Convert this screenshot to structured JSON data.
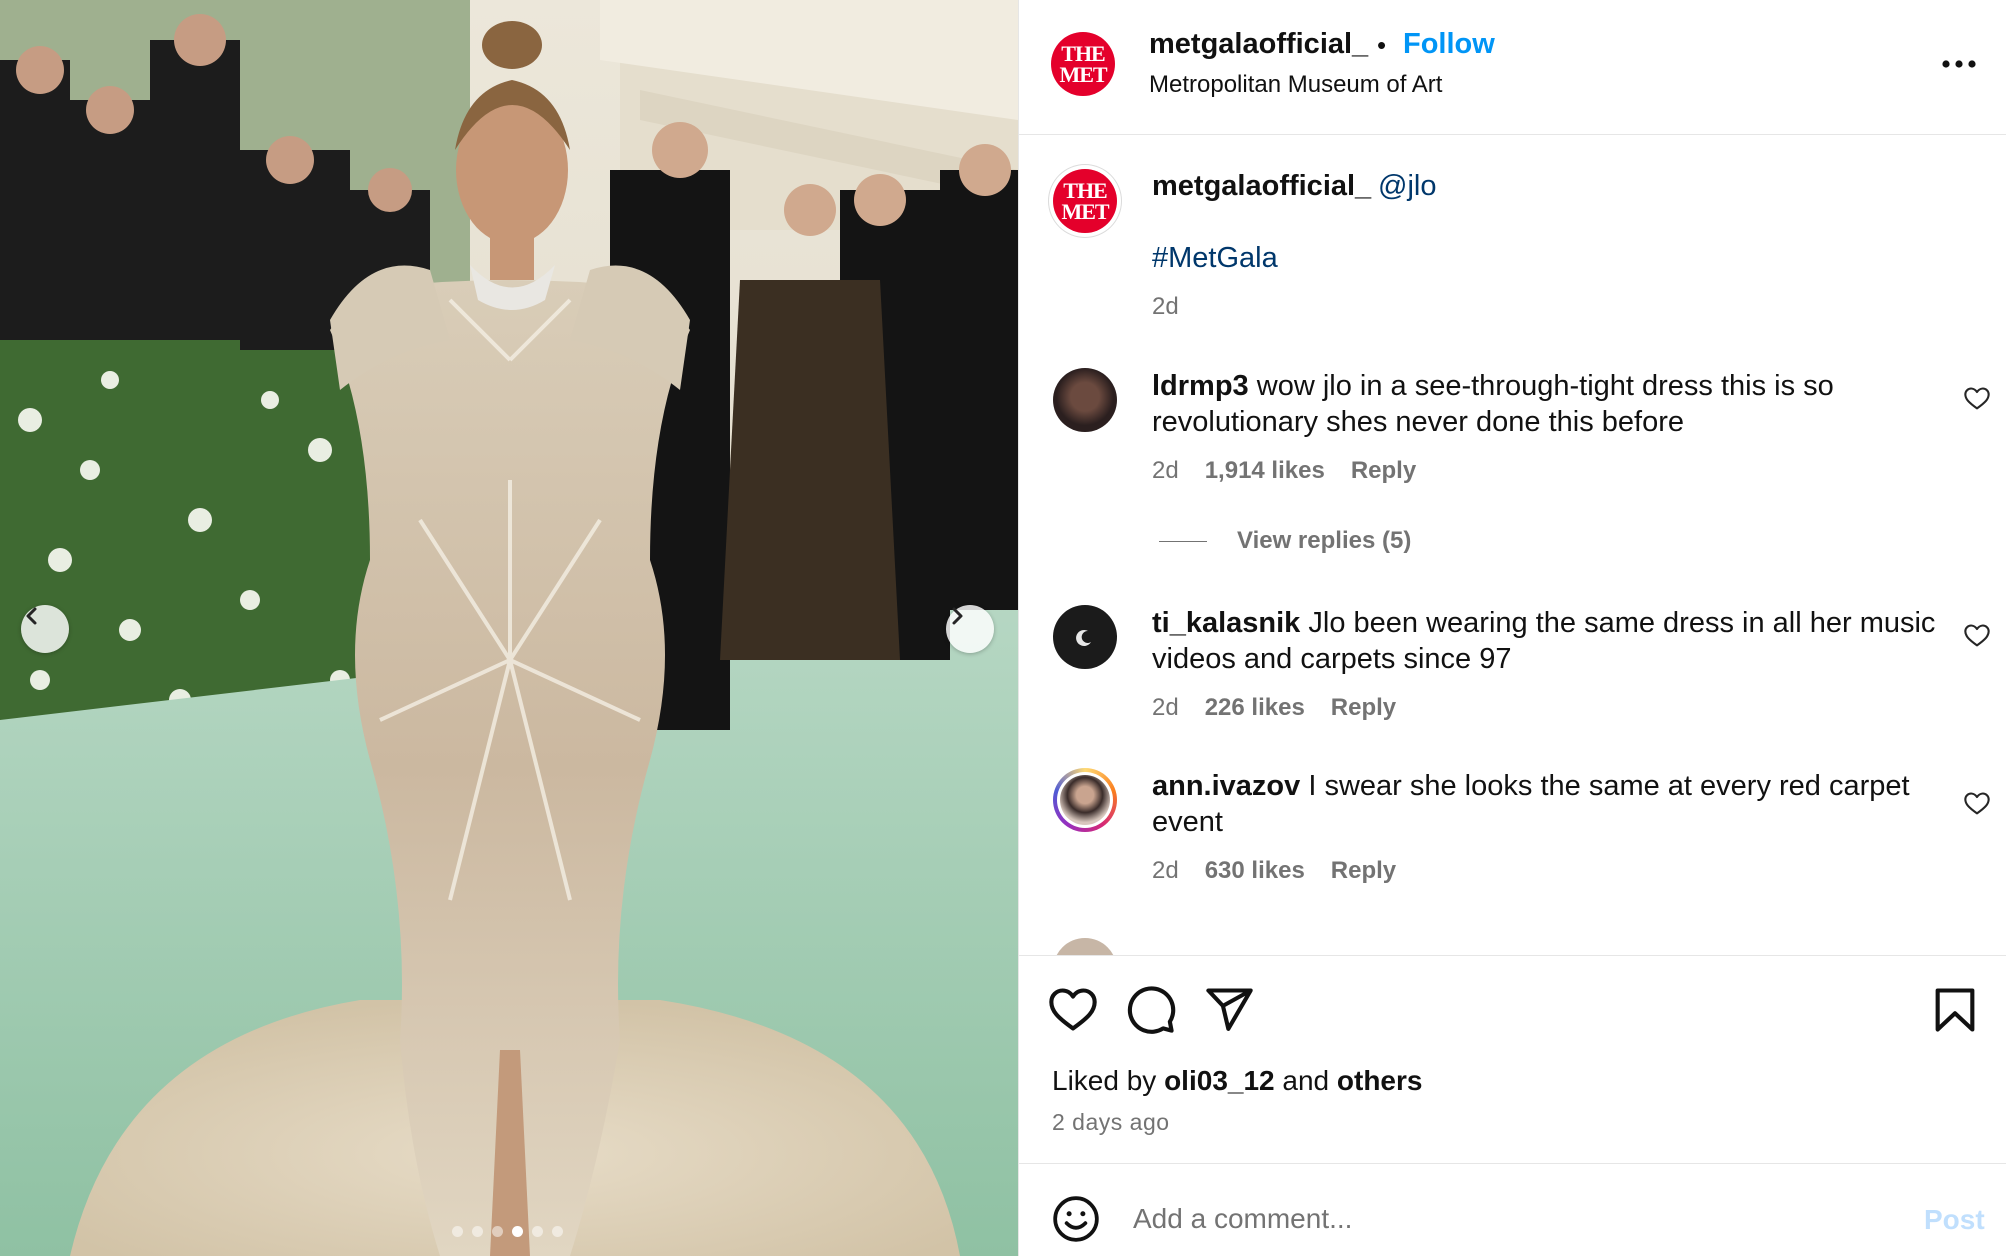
{
  "post": {
    "author": "metgalaofficial_",
    "follow_label": "Follow",
    "separator": "•",
    "location": "Metropolitan Museum of Art",
    "logo_text_line1": "THE",
    "logo_text_line2": "MET",
    "more_icon": "more-horizontal-icon"
  },
  "caption": {
    "author": "metgalaofficial_",
    "mention": "@jlo",
    "hashtag": "#MetGala",
    "time": "2d"
  },
  "comments": [
    {
      "user": "ldrmp3",
      "text": "wow jlo in a see-through-tight dress this is so revolutionary shes never done this before",
      "time": "2d",
      "likes": "1,914 likes",
      "reply_label": "Reply",
      "view_replies": "View replies (5)"
    },
    {
      "user": "ti_kalasnik",
      "text": "Jlo been wearing the same dress in all her music videos and carpets since 97",
      "time": "2d",
      "likes": "226 likes",
      "reply_label": "Reply"
    },
    {
      "user": "ann.ivazov",
      "text": "I swear she looks the same at every red carpet event",
      "time": "2d",
      "likes": "630 likes",
      "reply_label": "Reply"
    }
  ],
  "actions": {
    "liked_prefix": "Liked by",
    "liked_user": "oli03_12",
    "liked_and": "and",
    "liked_others": "others",
    "posted_ago": "2 days ago"
  },
  "add_comment": {
    "placeholder": "Add a comment...",
    "post_label": "Post"
  },
  "carousel": {
    "slide_count": 6,
    "active_slide": 4
  },
  "colors": {
    "accent": "#0095f6",
    "link": "#00376b",
    "met_red": "#e4002b",
    "muted": "#737373"
  }
}
